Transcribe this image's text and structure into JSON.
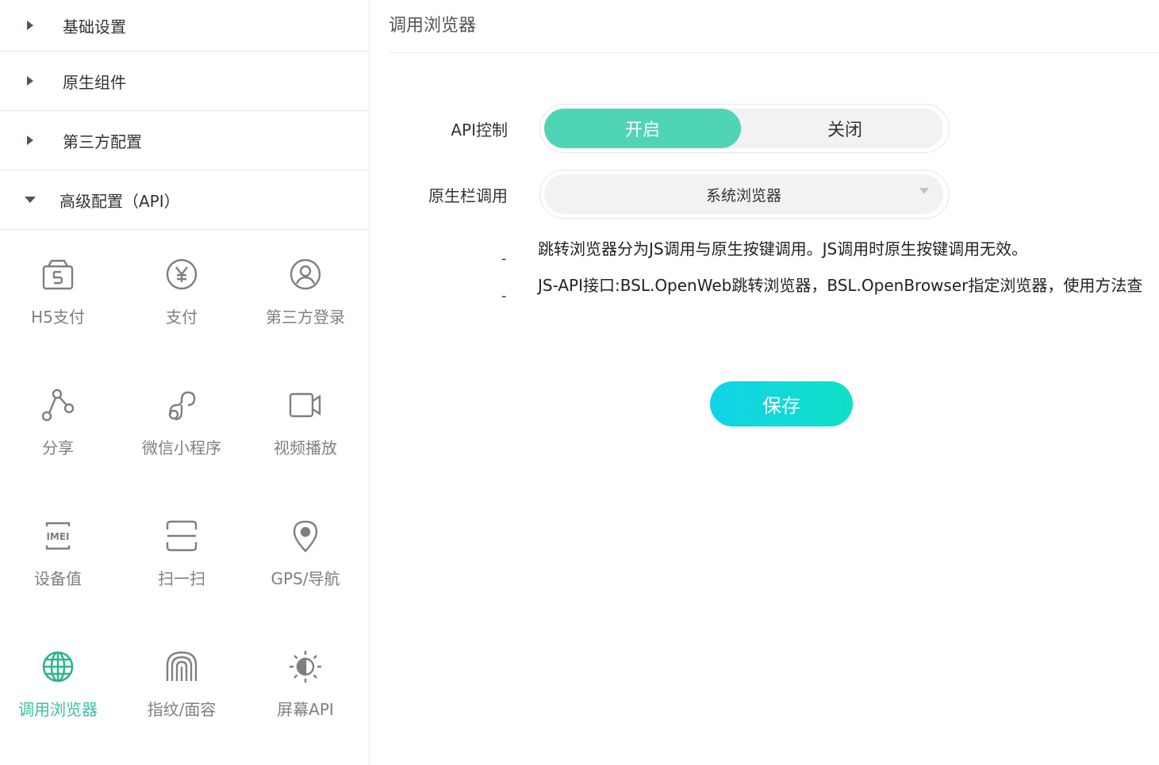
{
  "sidebar": {
    "sections": [
      {
        "label": "基础设置",
        "expanded": false
      },
      {
        "label": "原生组件",
        "expanded": false
      },
      {
        "label": "第三方配置",
        "expanded": false
      },
      {
        "label": "高级配置（API）",
        "expanded": true
      }
    ],
    "items": [
      {
        "label": "H5支付",
        "icon": "h5-pay-icon"
      },
      {
        "label": "支付",
        "icon": "yen-icon"
      },
      {
        "label": "第三方登录",
        "icon": "user-icon"
      },
      {
        "label": "分享",
        "icon": "share-icon"
      },
      {
        "label": "微信小程序",
        "icon": "mini-program-icon"
      },
      {
        "label": "视频播放",
        "icon": "video-icon"
      },
      {
        "label": "设备值",
        "icon": "imei-icon"
      },
      {
        "label": "扫一扫",
        "icon": "scan-icon"
      },
      {
        "label": "GPS/导航",
        "icon": "location-pin-icon"
      },
      {
        "label": "调用浏览器",
        "icon": "globe-icon",
        "active": true
      },
      {
        "label": "指纹/面容",
        "icon": "fingerprint-icon"
      },
      {
        "label": "屏幕API",
        "icon": "brightness-icon"
      }
    ],
    "active_color": "#3cbfa5",
    "inactive_color": "#7f7f7f"
  },
  "main": {
    "title": "调用浏览器",
    "api_control": {
      "label": "API控制",
      "on_label": "开启",
      "off_label": "关闭",
      "selected": "开启",
      "accent": "#4fd4b5"
    },
    "native_bar": {
      "label": "原生栏调用",
      "value": "系统浏览器"
    },
    "notes": {
      "bullet": "-",
      "line1": "跳转浏览器分为JS调用与原生按键调用。JS调用时原生按键调用无效。",
      "line2": "JS-API接口:BSL.OpenWeb跳转浏览器，BSL.OpenBrowser指定浏览器，使用方法查"
    },
    "save_label": "保存"
  }
}
